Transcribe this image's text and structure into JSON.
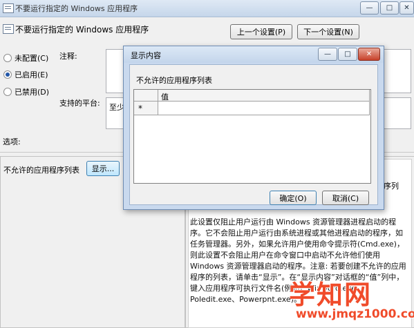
{
  "window": {
    "title": "不要运行指定的 Windows 应用程序",
    "minimize": "—",
    "maximize": "□",
    "close": "✕"
  },
  "header": {
    "policy_title": "不要运行指定的 Windows 应用程序",
    "prev_button": "上一个设置(P)",
    "next_button": "下一个设置(N)"
  },
  "state": {
    "options": [
      {
        "label": "未配置(C)",
        "selected": false
      },
      {
        "label": "已启用(E)",
        "selected": true
      },
      {
        "label": "已禁用(D)",
        "selected": false
      }
    ]
  },
  "labels": {
    "comment": "注释:",
    "supported": "支持的平台:",
    "supported_value": "至少",
    "options": "选项:"
  },
  "options_panel": {
    "list_label": "不允许的应用程序列表",
    "show_button": "显示..."
  },
  "dialog": {
    "title": "显示内容",
    "list_heading": "不允许的应用程序列表",
    "column_header": "值",
    "new_row_marker": "*",
    "ok_button": "确定(O)",
    "cancel_button": "取消(C)",
    "minimize": "—",
    "maximize": "□",
    "close": "✕"
  },
  "help": {
    "partial_line": "序列",
    "text": "此设置仅阻止用户运行由 Windows 资源管理器进程启动的程序。它不会阻止用户运行由系统进程或其他进程启动的程序，如任务管理器。另外，如果允许用户使用命令提示符(Cmd.exe)，则此设置不会阻止用户在命令窗口中启动不允许他们使用 Windows 资源管理器启动的程序。注意: 若要创建不允许的应用程序的列表，请单击“显示”。在“显示内容”对话框的“值”列中，键入应用程序可执行文件名(例如，Winword.exe、Poledit.exe、Powerpnt.exe)。"
  },
  "watermark": {
    "logo": "学知网",
    "url": "www.jmqz1000.com"
  }
}
